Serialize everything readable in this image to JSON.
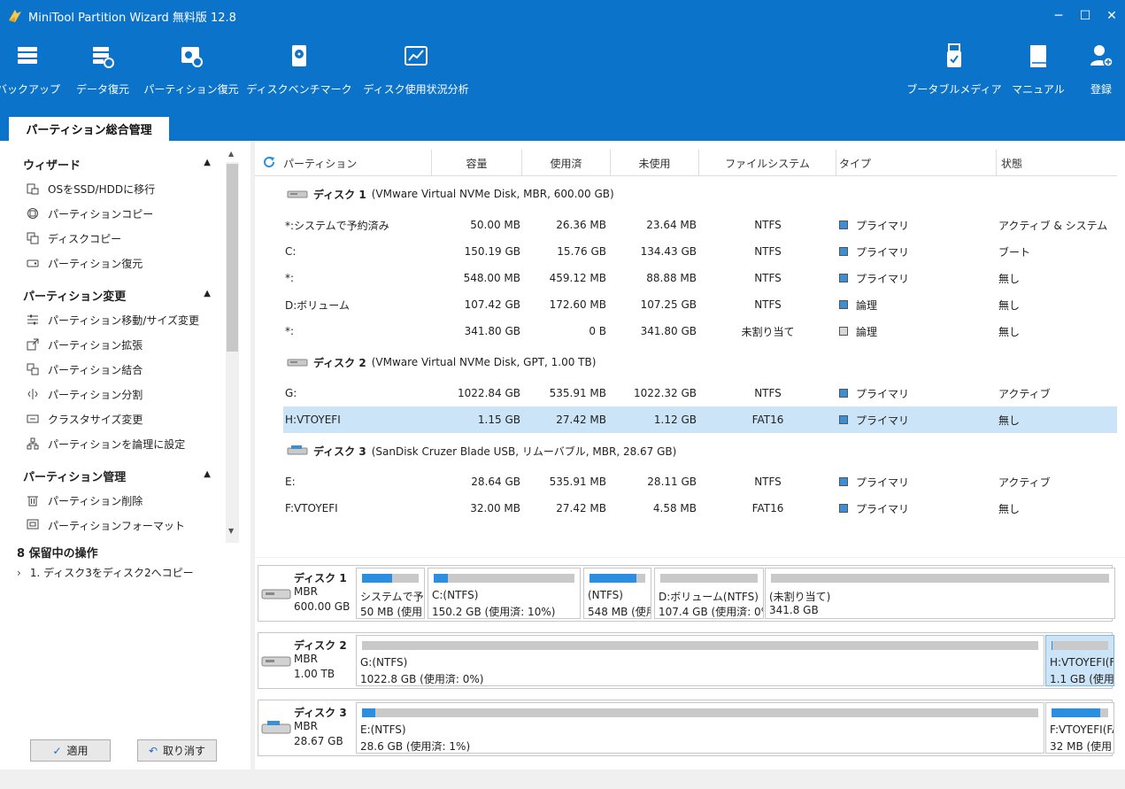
{
  "window": {
    "title": "MiniTool Partition Wizard 無料版 12.8",
    "min": "─",
    "max": "☐",
    "close": "✕"
  },
  "toolbar": {
    "backup": "バックアップ",
    "data_recovery": "データ復元",
    "partition_recovery": "パーティション復元",
    "benchmark": "ディスクベンチマーク",
    "space_analyzer": "ディスク使用状況分析",
    "bootable_media": "ブータブルメディア",
    "manual": "マニュアル",
    "login": "登録"
  },
  "tab": {
    "label": "パーティション総合管理"
  },
  "sidebar": {
    "sections": [
      {
        "title": "ウィザード",
        "items": [
          "OSをSSD/HDDに移行",
          "パーティションコピー",
          "ディスクコピー",
          "パーティション復元"
        ]
      },
      {
        "title": "パーティション変更",
        "items": [
          "パーティション移動/サイズ変更",
          "パーティション拡張",
          "パーティション結合",
          "パーティション分割",
          "クラスタサイズ変更",
          "パーティションを論理に設定"
        ]
      },
      {
        "title": "パーティション管理",
        "items": [
          "パーティション削除",
          "パーティションフォーマット"
        ]
      }
    ],
    "pending_title": "8 保留中の操作",
    "pending_items": [
      "1. ディスク3をディスク2へコピー"
    ],
    "apply": "適用",
    "undo": "取り消す"
  },
  "table": {
    "headers": [
      "パーティション",
      "容量",
      "使用済",
      "未使用",
      "ファイルシステム",
      "タイプ",
      "状態"
    ],
    "disks": [
      {
        "label": "ディスク 1",
        "detail": "(VMware Virtual NVMe Disk, MBR, 600.00 GB)",
        "rows": [
          [
            "*:システムで予約済み",
            "50.00 MB",
            "26.36 MB",
            "23.64 MB",
            "NTFS",
            "プライマリ",
            "アクティブ & システム"
          ],
          [
            "C:",
            "150.19 GB",
            "15.76 GB",
            "134.43 GB",
            "NTFS",
            "プライマリ",
            "ブート"
          ],
          [
            "*:",
            "548.00 MB",
            "459.12 MB",
            "88.88 MB",
            "NTFS",
            "プライマリ",
            "無し"
          ],
          [
            "D:ボリューム",
            "107.42 GB",
            "172.60 MB",
            "107.25 GB",
            "NTFS",
            "論理",
            "無し"
          ],
          [
            "*:",
            "341.80 GB",
            "0 B",
            "341.80 GB",
            "未割り当て",
            "論理",
            "無し"
          ]
        ]
      },
      {
        "label": "ディスク 2",
        "detail": "(VMware Virtual NVMe Disk, GPT, 1.00 TB)",
        "rows": [
          [
            "G:",
            "1022.84 GB",
            "535.91 MB",
            "1022.32 GB",
            "NTFS",
            "プライマリ",
            "アクティブ"
          ],
          [
            "H:VTOYEFI",
            "1.15 GB",
            "27.42 MB",
            "1.12 GB",
            "FAT16",
            "プライマリ",
            "無し"
          ]
        ]
      },
      {
        "label": "ディスク 3",
        "detail": "(SanDisk Cruzer Blade USB, リムーバブル, MBR, 28.67 GB)",
        "rows": [
          [
            "E:",
            "28.64 GB",
            "535.91 MB",
            "28.11 GB",
            "NTFS",
            "プライマリ",
            "アクティブ"
          ],
          [
            "F:VTOYEFI",
            "32.00 MB",
            "27.42 MB",
            "4.58 MB",
            "FAT16",
            "プライマリ",
            "無し"
          ]
        ]
      }
    ]
  },
  "diskmap": [
    {
      "name": "ディスク 1",
      "type": "MBR",
      "size": "600.00 GB",
      "parts": [
        {
          "label": "システムで予約",
          "info": "50 MB (使用",
          "used": 0.53
        },
        {
          "label": "C:(NTFS)",
          "info": "150.2 GB (使用済: 10%)",
          "used": 0.1
        },
        {
          "label": "(NTFS)",
          "info": "548 MB (使用",
          "used": 0.84
        },
        {
          "label": "D:ボリューム(NTFS)",
          "info": "107.4 GB (使用済: 0%",
          "used": 0.0
        },
        {
          "label": "(未割り当て)",
          "info": "341.8 GB",
          "used": 0.0
        }
      ]
    },
    {
      "name": "ディスク 2",
      "type": "MBR",
      "size": "1.00 TB",
      "parts": [
        {
          "label": "G:(NTFS)",
          "info": "1022.8 GB (使用済: 0%)",
          "used": 0.0
        },
        {
          "label": "H:VTOYEFI(F",
          "info": "1.1 GB (使用",
          "used": 0.02
        }
      ]
    },
    {
      "name": "ディスク 3",
      "type": "MBR",
      "size": "28.67 GB",
      "parts": [
        {
          "label": "E:(NTFS)",
          "info": "28.6 GB (使用済: 1%)",
          "used": 0.02
        },
        {
          "label": "F:VTOYEFI(FA",
          "info": "32 MB (使用",
          "used": 0.86
        }
      ]
    }
  ],
  "colors": {
    "accent": "#0b73c9",
    "selection": "#cce4f7",
    "bar_fill": "#2b8ee0",
    "bar_empty": "#c9c9c9",
    "type_square": "#3a8fd6"
  }
}
